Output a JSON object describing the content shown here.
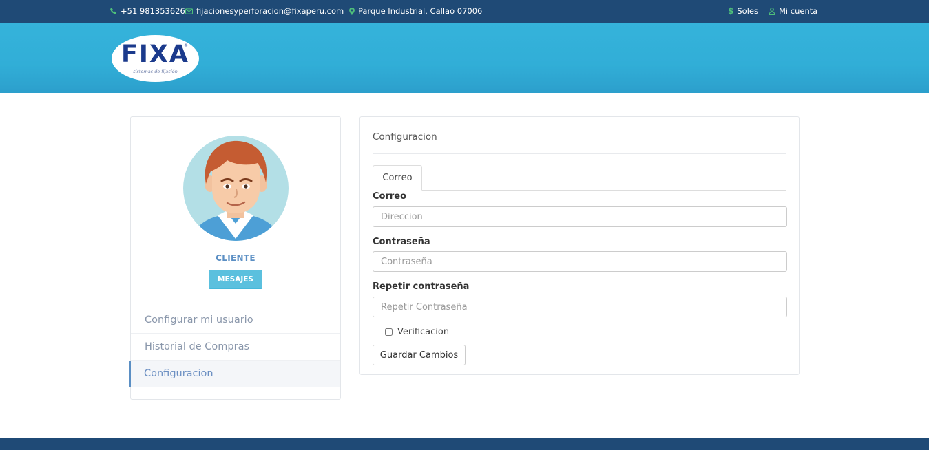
{
  "topbar": {
    "phone": "+51 981353626",
    "email": "fijacionesyperforacion@fixaperu.com",
    "address": "Parque Industrial, Callao 07006",
    "currency": "Soles",
    "account": "Mi cuenta",
    "phone_icon": "phone-icon",
    "email_icon": "envelope-icon",
    "address_icon": "map-marker-icon",
    "currency_icon": "dollar-icon",
    "account_icon": "user-icon",
    "icon_color": "#4fc07a",
    "bg_color": "#1f4a76"
  },
  "header": {
    "brand": "FIXA",
    "registered": "®",
    "tagline": "sistemas de fijación",
    "bg_color": "#31aed7"
  },
  "sidebar": {
    "role": "CLIENTE",
    "messages_label": "MESAJES",
    "items": [
      {
        "label": "Configurar mi usuario",
        "active": false
      },
      {
        "label": "Historial de Compras",
        "active": false
      },
      {
        "label": "Configuracion",
        "active": true
      }
    ]
  },
  "panel": {
    "title": "Configuracion",
    "tabs": [
      {
        "label": "Correo",
        "active": true
      }
    ],
    "fields": [
      {
        "label": "Correo",
        "placeholder": "Direccion",
        "value": ""
      },
      {
        "label": "Contraseña",
        "placeholder": "Contraseña",
        "value": ""
      },
      {
        "label": "Repetir contraseña",
        "placeholder": "Repetir Contraseña",
        "value": ""
      }
    ],
    "checkbox_label": "Verificacion",
    "checkbox_checked": false,
    "save_label": "Guardar Cambios"
  }
}
